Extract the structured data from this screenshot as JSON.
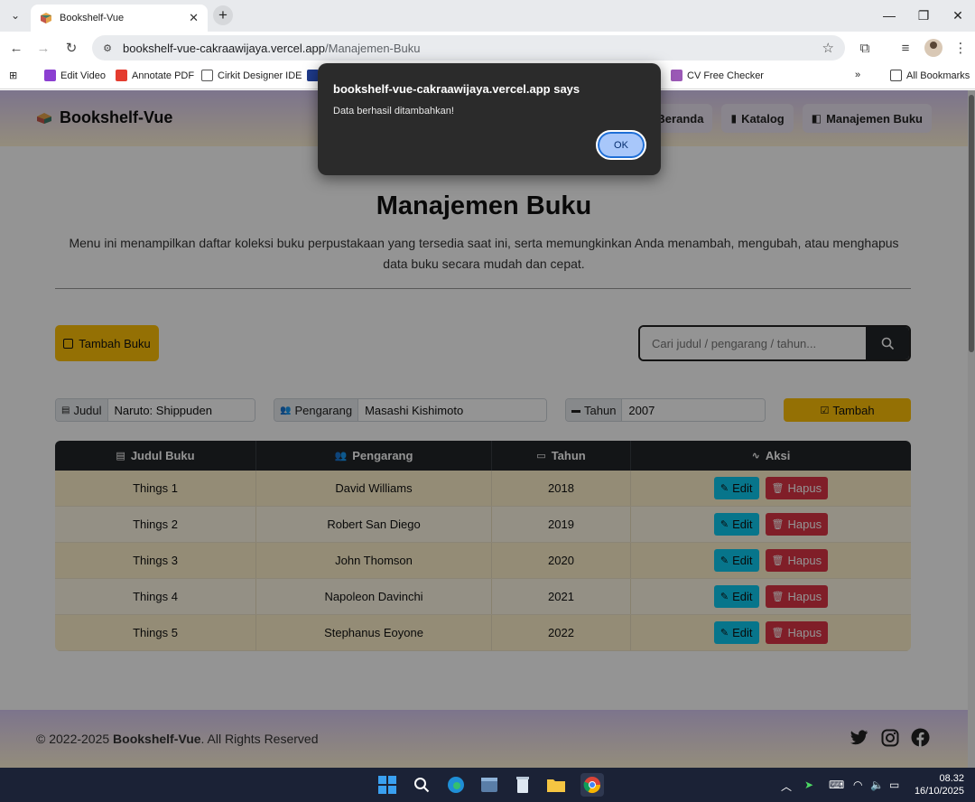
{
  "browser": {
    "tab_title": "Bookshelf-Vue",
    "url_domain": "bookshelf-vue-cakraawijaya.vercel.app",
    "url_path": "/Manajemen-Buku",
    "bookmarks": [
      "Edit Video",
      "Annotate PDF",
      "Cirkit Designer IDE",
      "CV Free Checker",
      "All Bookmarks"
    ]
  },
  "navbar": {
    "brand": "Bookshelf-Vue",
    "links": [
      {
        "label": "Beranda",
        "icon": "home-icon"
      },
      {
        "label": "Katalog",
        "icon": "book-icon"
      },
      {
        "label": "Manajemen Buku",
        "icon": "open-book-icon"
      }
    ]
  },
  "main": {
    "title": "Manajemen Buku",
    "description": "Menu ini menampilkan daftar koleksi buku perpustakaan yang tersedia saat ini, serta memungkinkan Anda menambah, mengubah, atau menghapus data buku secara mudah dan cepat.",
    "add_book_label": "Tambah Buku",
    "search_placeholder": "Cari judul / pengarang / tahun..."
  },
  "form": {
    "judul_label": "Judul",
    "judul_value": "Naruto: Shippuden",
    "pengarang_label": "Pengarang",
    "pengarang_value": "Masashi Kishimoto",
    "tahun_label": "Tahun",
    "tahun_value": "2007",
    "submit_label": "Tambah"
  },
  "table": {
    "headers": [
      "Judul Buku",
      "Pengarang",
      "Tahun",
      "Aksi"
    ],
    "rows": [
      {
        "judul": "Things 1",
        "pengarang": "David Williams",
        "tahun": "2018"
      },
      {
        "judul": "Things 2",
        "pengarang": "Robert San Diego",
        "tahun": "2019"
      },
      {
        "judul": "Things 3",
        "pengarang": "John Thomson",
        "tahun": "2020"
      },
      {
        "judul": "Things 4",
        "pengarang": "Napoleon Davinchi",
        "tahun": "2021"
      },
      {
        "judul": "Things 5",
        "pengarang": "Stephanus Eoyone",
        "tahun": "2022"
      }
    ],
    "edit_label": "Edit",
    "delete_label": "Hapus"
  },
  "footer": {
    "copy_prefix": "© 2022-2025 ",
    "copy_brand": "Bookshelf-Vue",
    "copy_suffix": ". All Rights Reserved"
  },
  "dialog": {
    "title": "bookshelf-vue-cakraawijaya.vercel.app says",
    "message": "Data berhasil ditambahkan!",
    "ok_label": "OK"
  },
  "taskbar": {
    "time": "08.32",
    "date": "16/10/2025"
  },
  "colors": {
    "warning": "#ffc107",
    "info": "#0dcaf0",
    "danger": "#dc3545",
    "dark": "#212529"
  }
}
